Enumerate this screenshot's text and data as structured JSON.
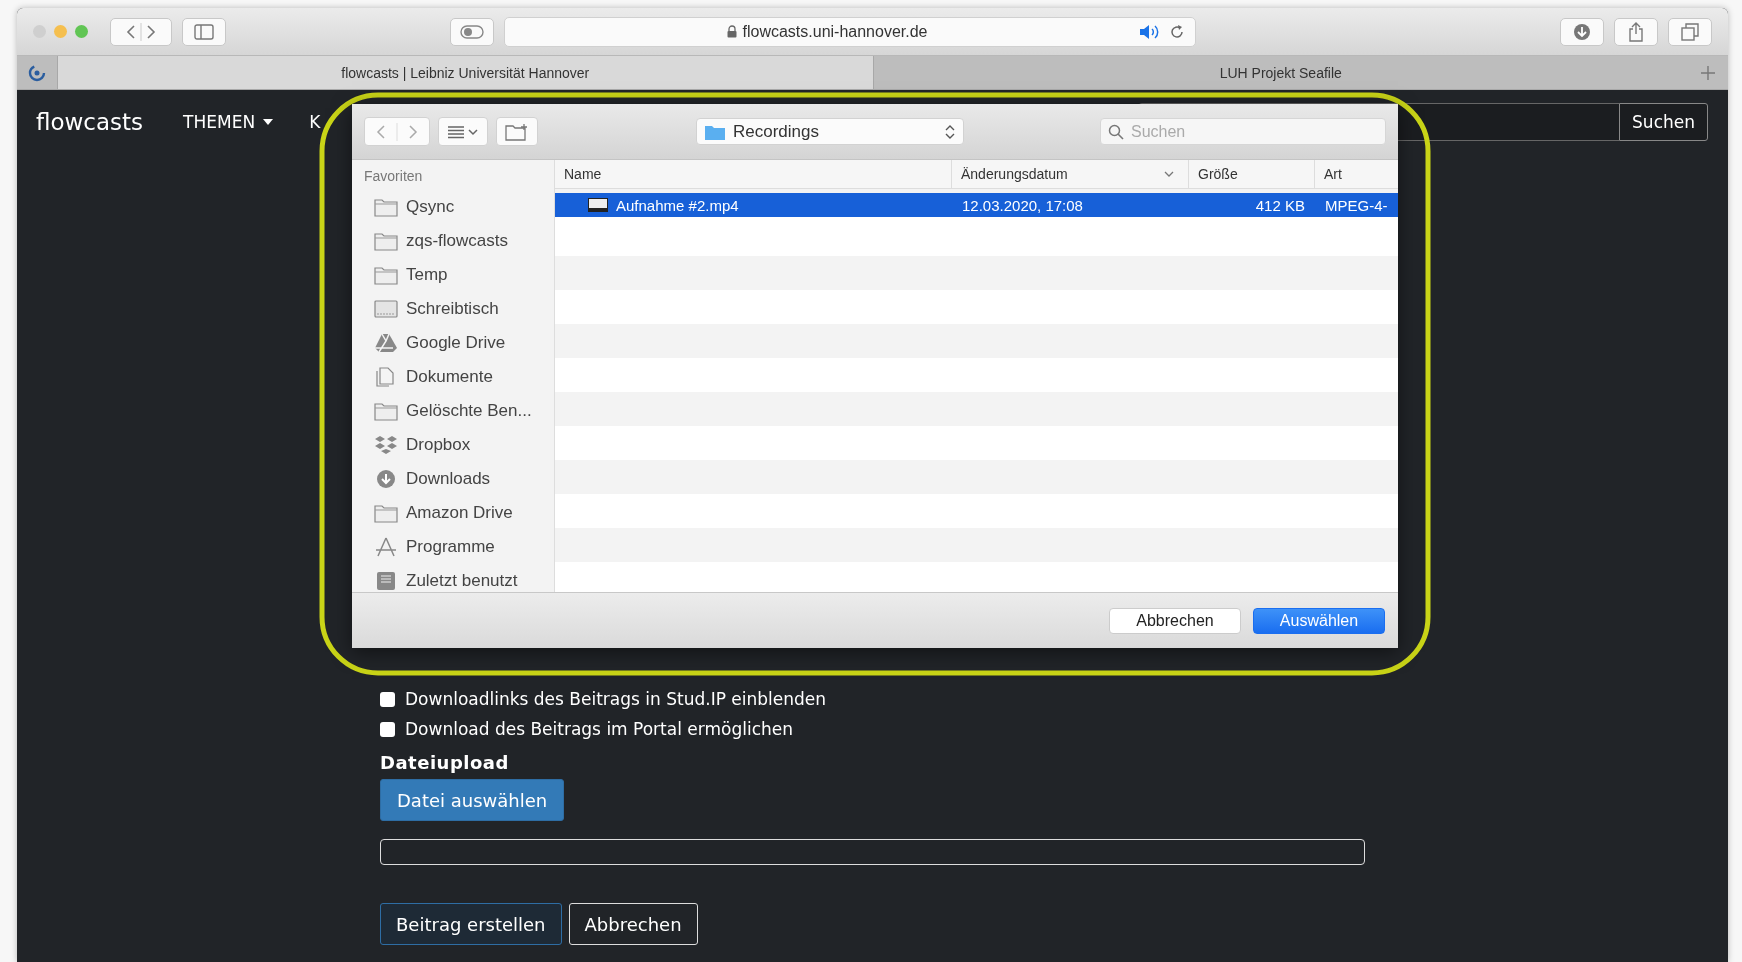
{
  "browser": {
    "url": "flowcasts.uni-hannover.de",
    "tabs": [
      {
        "title": "flowcasts | Leibniz Universität Hannover",
        "selected": true
      },
      {
        "title": "LUH Projekt Seafile",
        "selected": false
      }
    ]
  },
  "navbar": {
    "brand": "flowcasts",
    "items": [
      {
        "label": "THEMEN",
        "dropdown": true
      },
      {
        "label": "K",
        "dropdown": false
      }
    ],
    "search_button": "Suchen"
  },
  "dialog": {
    "location": "Recordings",
    "search": {
      "placeholder": "Suchen"
    },
    "sidebar": {
      "heading": "Favoriten",
      "items": [
        {
          "label": "Qsync",
          "kind": "folder"
        },
        {
          "label": "zqs-flowcasts",
          "kind": "folder"
        },
        {
          "label": "Temp",
          "kind": "folder"
        },
        {
          "label": "Schreibtisch",
          "kind": "desktop"
        },
        {
          "label": "Google Drive",
          "kind": "drive"
        },
        {
          "label": "Dokumente",
          "kind": "document"
        },
        {
          "label": "Gelöschte Ben...",
          "kind": "folder"
        },
        {
          "label": "Dropbox",
          "kind": "dropbox"
        },
        {
          "label": "Downloads",
          "kind": "download"
        },
        {
          "label": "Amazon Drive",
          "kind": "folder"
        },
        {
          "label": "Programme",
          "kind": "apps"
        },
        {
          "label": "Zuletzt benutzt",
          "kind": "recent"
        }
      ]
    },
    "columns": [
      {
        "label": "Name",
        "sorted": false
      },
      {
        "label": "Änderungsdatum",
        "sorted": true
      },
      {
        "label": "Größe",
        "sorted": false
      },
      {
        "label": "Art",
        "sorted": false
      }
    ],
    "files": [
      {
        "name": "Aufnahme #2.mp4",
        "modified": "12.03.2020, 17:08",
        "size": "412 KB",
        "kind": "MPEG-4-",
        "selected": true
      }
    ],
    "buttons": [
      {
        "label": "Abbrechen",
        "primary": false
      },
      {
        "label": "Auswählen",
        "primary": true
      }
    ]
  },
  "form": {
    "options": [
      {
        "label": "Downloadlinks des Beitrags in Stud.IP einblenden",
        "checked": false
      },
      {
        "label": "Download des Beitrags im Portal ermöglichen",
        "checked": false
      }
    ],
    "upload_heading": "Dateiupload",
    "upload_button": "Datei auswählen",
    "upload_progress": {
      "level": 0
    },
    "buttons": [
      {
        "label": "Beitrag erstellen",
        "primary": true
      },
      {
        "label": "Abbrechen",
        "primary": false
      }
    ]
  }
}
